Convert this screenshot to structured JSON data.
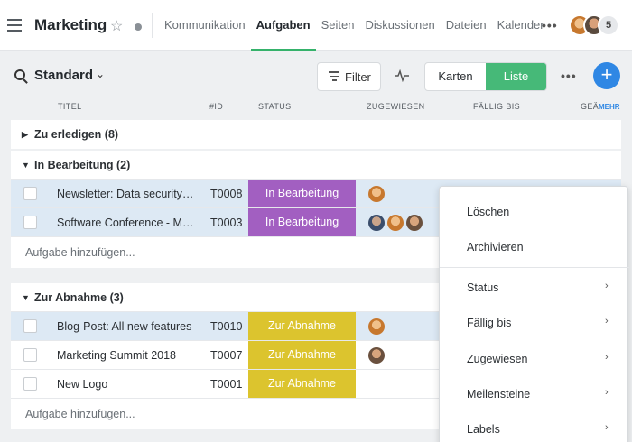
{
  "header": {
    "title": "Marketing",
    "tabs": [
      "Kommunikation",
      "Aufgaben",
      "Seiten",
      "Diskussionen",
      "Dateien",
      "Kalender"
    ],
    "active_tab": "Aufgaben",
    "member_count": "5"
  },
  "toolbar": {
    "view": "Standard",
    "filter_label": "Filter",
    "view_modes": [
      "Karten",
      "Liste"
    ],
    "active_view_mode": "Liste"
  },
  "columns": {
    "titel": "TITEL",
    "id": "#ID",
    "status": "STATUS",
    "zugewiesen": "ZUGEWIESEN",
    "faellig": "FÄLLIG BIS",
    "gea": "GEÄ",
    "mehr": "MEHR"
  },
  "groups": [
    {
      "label": "Zu erledigen (8)",
      "expanded": false
    },
    {
      "label": "In Bearbeitung (2)",
      "expanded": true,
      "rows": [
        {
          "title": "Newsletter: Data security…",
          "id": "T0008",
          "status": "In Bearbeitung",
          "avatars": [
            "orange"
          ]
        },
        {
          "title": "Software Conference - M…",
          "id": "T0003",
          "status": "In Bearbeitung",
          "avatars": [
            "blue",
            "orange",
            "brown"
          ]
        }
      ],
      "add_label": "Aufgabe hinzufügen..."
    },
    {
      "label": "Zur Abnahme (3)",
      "expanded": true,
      "rows": [
        {
          "title": "Blog-Post: All new features",
          "id": "T0010",
          "status": "Zur Abnahme",
          "avatars": [
            "orange"
          ]
        },
        {
          "title": "Marketing Summit 2018",
          "id": "T0007",
          "status": "Zur Abnahme",
          "avatars": [
            "brown"
          ]
        },
        {
          "title": "New Logo",
          "id": "T0001",
          "status": "Zur Abnahme",
          "avatars": []
        }
      ],
      "add_label": "Aufgabe hinzufügen..."
    }
  ],
  "context_menu": {
    "items": [
      "Löschen",
      "Archivieren"
    ],
    "submenus": [
      "Status",
      "Fällig bis",
      "Zugewiesen",
      "Meilensteine",
      "Labels"
    ]
  },
  "colors": {
    "accent_green": "#46b978",
    "accent_blue": "#2f87e4",
    "status_in_bearbeitung": "#a25fc1",
    "status_zur_abnahme": "#dcc42e",
    "selected_row": "#dde9f4"
  }
}
